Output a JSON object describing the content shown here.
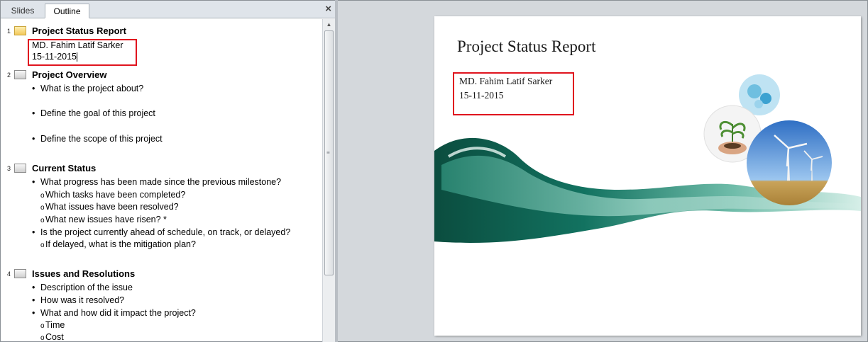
{
  "tabs": {
    "slides": "Slides",
    "outline": "Outline",
    "close": "×"
  },
  "outline": {
    "slides": [
      {
        "num": "1",
        "title": "Project Status Report",
        "lines": [
          "MD. Fahim Latif Sarker",
          "15-11-2015"
        ]
      },
      {
        "num": "2",
        "title": "Project Overview",
        "bullets": [
          "What is the project about?",
          "Define the goal of this project",
          "Define the scope of this project"
        ]
      },
      {
        "num": "3",
        "title": "Current Status",
        "b1": "What progress has been made since the previous milestone?",
        "b1_subs": [
          "Which tasks have been completed?",
          "What issues have been resolved?",
          "What new issues have risen? *"
        ],
        "b2": "Is the project currently ahead of schedule, on track, or delayed?",
        "b2_subs": [
          "If delayed, what is the mitigation plan?"
        ]
      },
      {
        "num": "4",
        "title": "Issues and Resolutions",
        "bullets": [
          "Description of the issue",
          "How was it resolved?",
          "What and how did it impact the project?"
        ],
        "subs": [
          "Time",
          "Cost"
        ]
      }
    ],
    "bullet_char": "•",
    "sub_char": "o"
  },
  "slide": {
    "title": "Project Status Report",
    "author": "MD. Fahim Latif Sarker",
    "date": "15-11-2015"
  },
  "colors": {
    "highlight_box": "#e0141e",
    "wave_dark": "#0f5a4a",
    "wave_light": "#7fc7b5"
  }
}
